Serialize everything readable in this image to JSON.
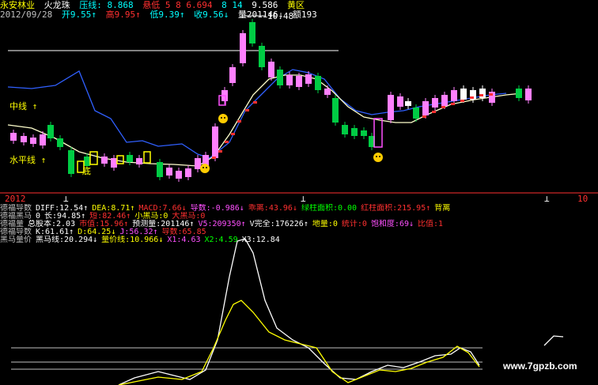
{
  "colors": {
    "bg": "#000000",
    "white": "#ffffff",
    "yellow": "#ffff00",
    "cyan": "#00ffff",
    "red": "#ff3030",
    "magenta": "#ff50ff",
    "green": "#00ff00",
    "blue": "#3060ff",
    "grey": "#c0c0c0",
    "pink": "#ff80ff",
    "candle_up": "#ff80ff",
    "candle_down": "#00cc44"
  },
  "header": {
    "stock_name": "永安林业",
    "indicator_name": "火龙珠",
    "segments": [
      {
        "text": "压线: 8.868",
        "color": "#00ffff"
      },
      {
        "text": "悬低 5 8 6.694",
        "color": "#ff3030"
      },
      {
        "text": "8 14",
        "color": "#00ffff"
      },
      {
        "text": "9.586",
        "color": "#ffffff"
      },
      {
        "text": "黄区",
        "color": "#ffff00"
      }
    ]
  },
  "quote": {
    "date": "2012/09/28",
    "items": [
      {
        "text": "开9.55↑",
        "color": "#00ffff"
      },
      {
        "text": "高9.95↑",
        "color": "#ff3030"
      },
      {
        "text": "低9.39↑",
        "color": "#00ffff"
      },
      {
        "text": "收9.56↓",
        "color": "#00ffff"
      },
      {
        "text": "量201146↓",
        "color": "#ffffff"
      },
      {
        "text": "额193",
        "color": "#ffffff"
      }
    ]
  },
  "price_chart": {
    "high_label": "10.48",
    "labels": {
      "middle_line": "中线 ↑",
      "horizontal_line": "水平线 ↑",
      "bottom_mark": "底"
    },
    "date_left": "2012",
    "date_right": "10"
  },
  "indicator_rows": [
    [
      {
        "text": "德福导数",
        "color": "#c0c0c0"
      },
      {
        "text": "DIFF:12.54↑",
        "color": "#ffffff"
      },
      {
        "text": "DEA:8.71↑",
        "color": "#ffff00"
      },
      {
        "text": "MACD:7.66↓",
        "color": "#ff3030"
      },
      {
        "text": "导数:-0.986↓",
        "color": "#ff50ff"
      },
      {
        "text": "乖离:43.96↓",
        "color": "#ff3030"
      },
      {
        "text": "绿柱面积:0.00",
        "color": "#00ff00"
      },
      {
        "text": "红柱面积:215.95↑",
        "color": "#ff3030"
      },
      {
        "text": "背离",
        "color": "#ffff00"
      }
    ],
    [
      {
        "text": "德福黑马",
        "color": "#c0c0c0"
      },
      {
        "text": "0",
        "color": "#ffffff"
      },
      {
        "text": "长:94.85↑",
        "color": "#ffffff"
      },
      {
        "text": "短:82.46↑",
        "color": "#ff3030"
      },
      {
        "text": "小黑马:0",
        "color": "#ffff00"
      },
      {
        "text": "大黑马:0",
        "color": "#ff3030"
      }
    ],
    [
      {
        "text": "德福量",
        "color": "#c0c0c0"
      },
      {
        "text": "总股本:2.03",
        "color": "#ffffff"
      },
      {
        "text": "市值:15.96↑",
        "color": "#ff3030"
      },
      {
        "text": "预测量:201146↑",
        "color": "#ffffff"
      },
      {
        "text": "V5:209350↑",
        "color": "#ff50ff"
      },
      {
        "text": "V完全:176226↑",
        "color": "#ffffff"
      },
      {
        "text": "地量:0",
        "color": "#ffff00"
      },
      {
        "text": "统计:0",
        "color": "#ff3030"
      },
      {
        "text": "饱和度:69↓",
        "color": "#ff50ff"
      },
      {
        "text": "比值:1",
        "color": "#ff3030"
      }
    ],
    [
      {
        "text": "德福导数",
        "color": "#c0c0c0"
      },
      {
        "text": "K:61.61↑",
        "color": "#ffffff"
      },
      {
        "text": "D:64.25↓",
        "color": "#ffff00"
      },
      {
        "text": "J:56.32↑",
        "color": "#ff50ff"
      },
      {
        "text": "导数:65.85",
        "color": "#ff3030"
      }
    ],
    [
      {
        "text": "黑马量价",
        "color": "#c0c0c0"
      },
      {
        "text": "黑马线:20.294↓",
        "color": "#ffffff"
      },
      {
        "text": "量价线:10.966↓",
        "color": "#ffff00"
      },
      {
        "text": "X1:4.63",
        "color": "#ff50ff"
      },
      {
        "text": "X2:4.59",
        "color": "#00ff00"
      },
      {
        "text": "X3:12.84",
        "color": "#ffffff"
      }
    ]
  ],
  "watermark": "www.7gpzb.com"
}
